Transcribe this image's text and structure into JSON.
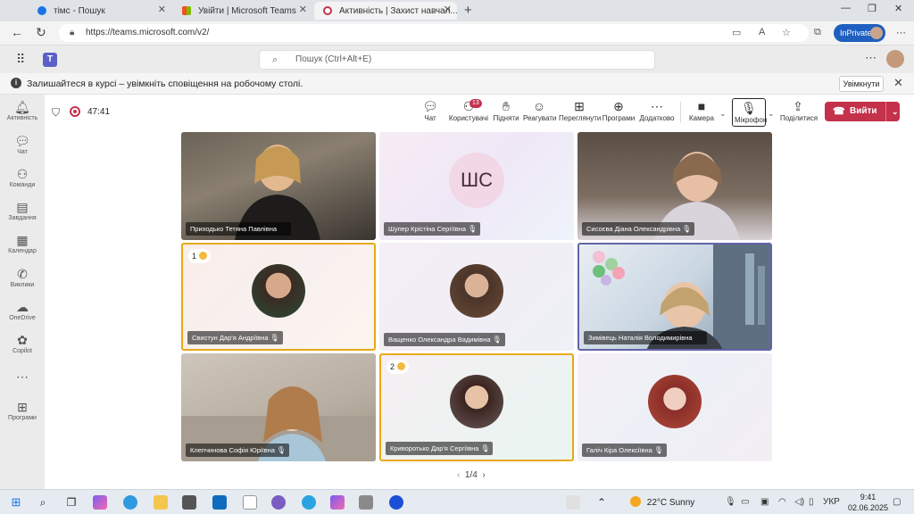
{
  "browser": {
    "tabs": [
      {
        "title": "тімс - Пошук",
        "favicon_color": "#1a73e8"
      },
      {
        "title": "Увійти | Microsoft Teams",
        "favicon_color": "#f25022"
      },
      {
        "title": "Активність | Захист навчал...",
        "favicon_color": "#c4314b"
      }
    ],
    "url": "https://teams.microsoft.com/v2/",
    "inprivate_label": "InPrivate"
  },
  "teams": {
    "search_placeholder": "Пошук (Ctrl+Alt+E)",
    "notification": {
      "text": "Залишайтеся в курсі – увімкніть сповіщення на робочому столі.",
      "button": "Увімкнути"
    },
    "rail": [
      {
        "label": "Активність",
        "icon": "bell-icon"
      },
      {
        "label": "Чат",
        "icon": "chat-icon"
      },
      {
        "label": "Команди",
        "icon": "teams-icon"
      },
      {
        "label": "Завдання",
        "icon": "assignments-icon"
      },
      {
        "label": "Календар",
        "icon": "calendar-icon"
      },
      {
        "label": "Виклики",
        "icon": "phone-icon"
      },
      {
        "label": "OneDrive",
        "icon": "cloud-icon"
      },
      {
        "label": "Copilot",
        "icon": "copilot-icon"
      },
      {
        "label": "",
        "icon": "more-icon"
      },
      {
        "label": "Програми",
        "icon": "apps-icon"
      }
    ]
  },
  "meeting": {
    "timer": "47:41",
    "toolbar": {
      "chat": "Чат",
      "people": "Користувачі",
      "people_count": "13",
      "raise": "Підняти",
      "react": "Реагувати",
      "view": "Переглянути",
      "apps": "Програми",
      "more": "Додатково",
      "camera": "Камера",
      "mic": "Мікрофон",
      "share": "Поділитися",
      "leave": "Вийти"
    },
    "tiles": [
      {
        "name": "Приходько Тетяна Павлівна",
        "muted": false,
        "kind": "video"
      },
      {
        "name": "Шупер Крістіна Сергіївна",
        "muted": true,
        "kind": "initials",
        "initials": "ШС"
      },
      {
        "name": "Сисоєва Діана Олександрівна",
        "muted": true,
        "kind": "video"
      },
      {
        "name": "Свистун Дар'я Андріївна",
        "muted": true,
        "kind": "avatar",
        "hand": "1"
      },
      {
        "name": "Ващенко Олександра Вадимівна",
        "muted": true,
        "kind": "avatar"
      },
      {
        "name": "Зимівець Наталія Володимирівна",
        "muted": false,
        "kind": "video"
      },
      {
        "name": "Клепчинова Софія Юріївна",
        "muted": true,
        "kind": "video"
      },
      {
        "name": "Криворотько Дар'я Сергіївна",
        "muted": true,
        "kind": "avatar",
        "hand": "2"
      },
      {
        "name": "Галіч Кіра Олексіївна",
        "muted": true,
        "kind": "avatar"
      }
    ],
    "pager": "1/4"
  },
  "taskbar": {
    "weather_temp": "22°C",
    "weather_text": "Sunny",
    "lang": "УКР",
    "time": "9:41",
    "date": "02.06.2025"
  }
}
